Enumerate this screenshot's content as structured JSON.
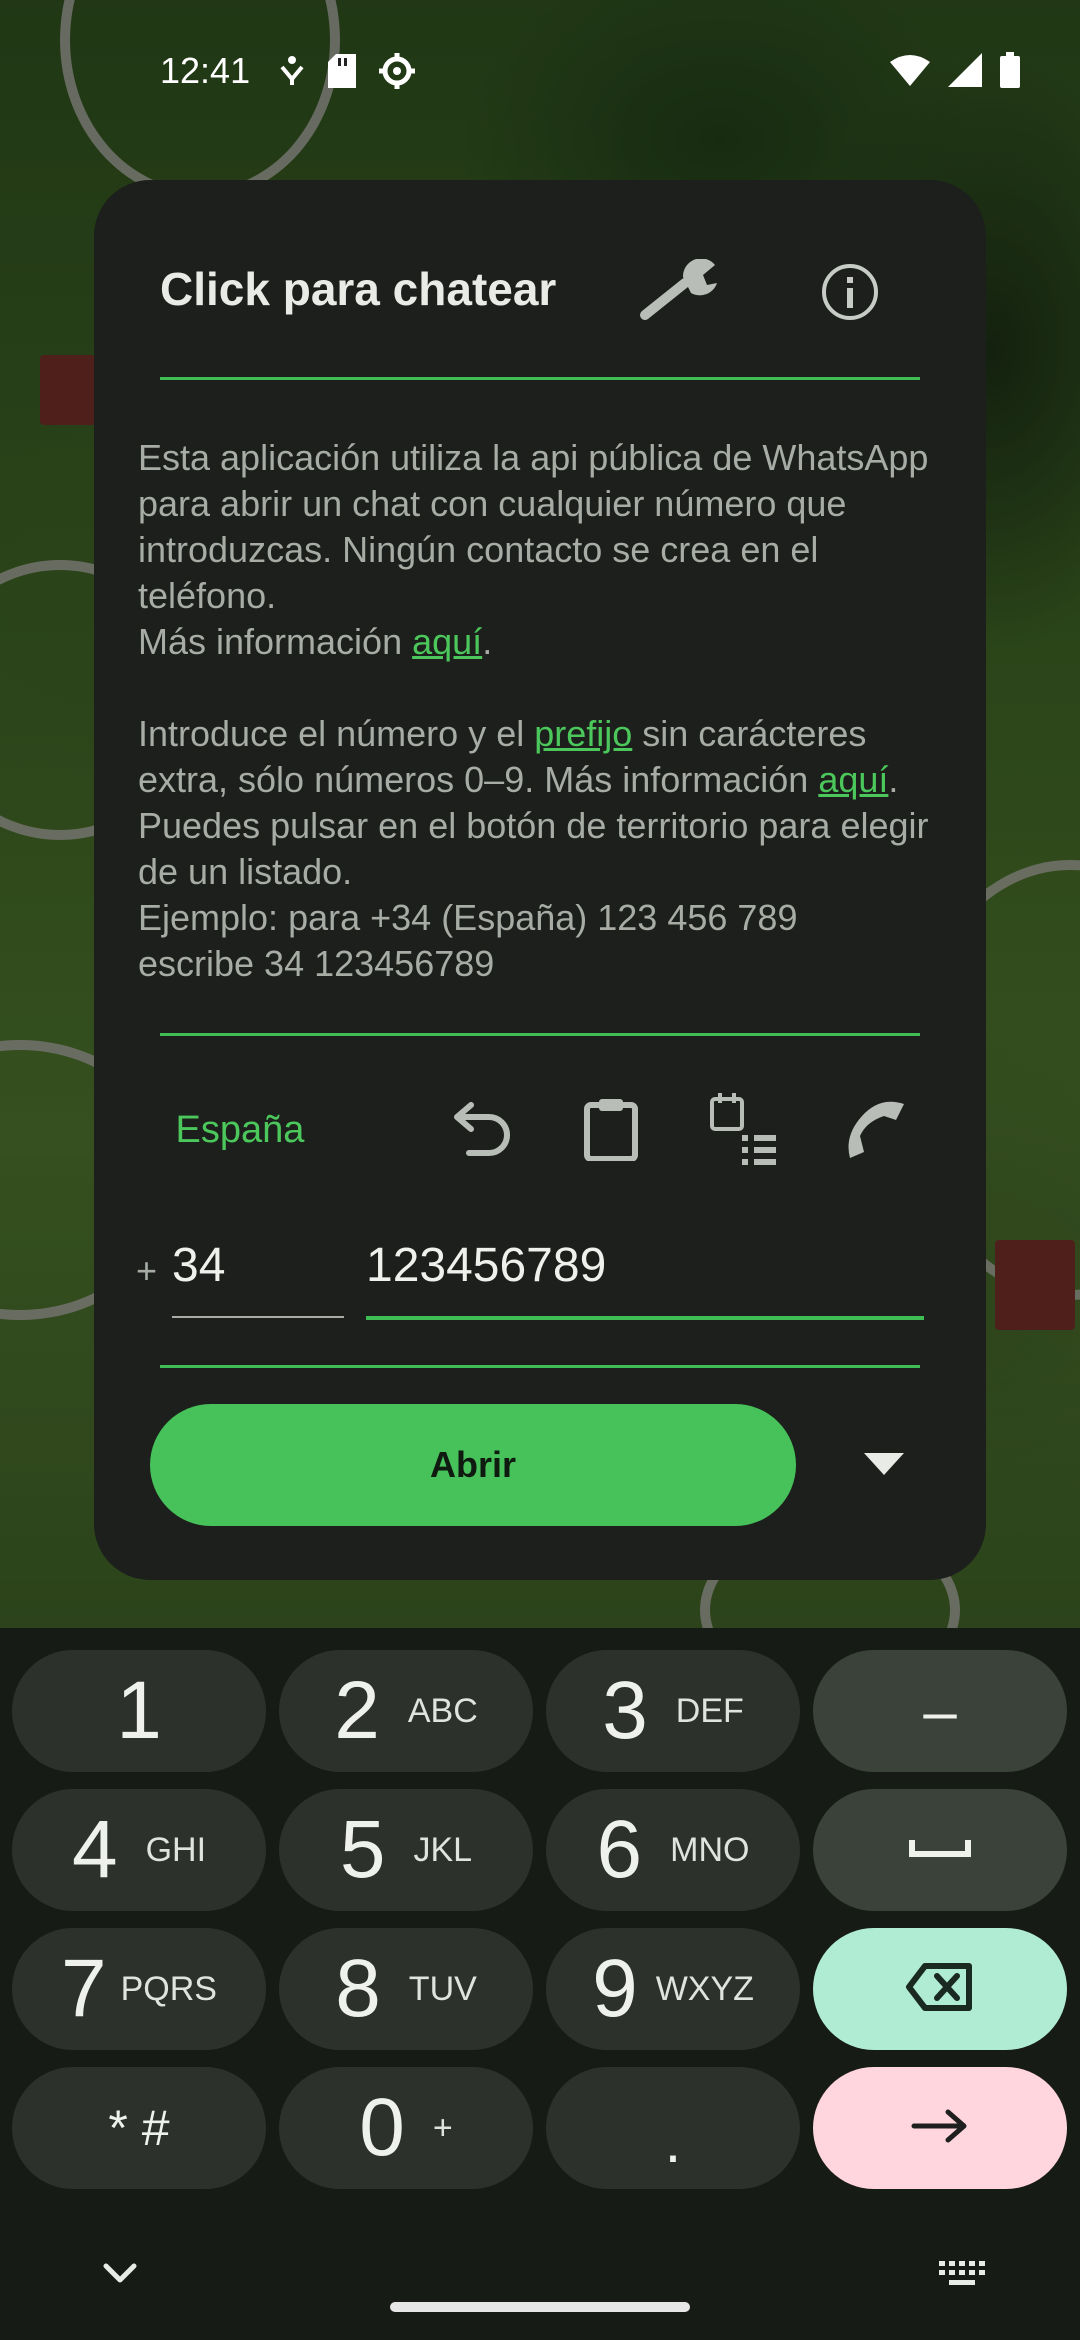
{
  "status_bar": {
    "time": "12:41"
  },
  "dialog": {
    "title": "Click para chatear",
    "description": {
      "p1": "Esta aplicación utiliza la api pública de WhatsApp para abrir un chat con cualquier número que introduzcas. Ningún contacto se crea en el teléfono.",
      "p1_more_prefix": "Más información ",
      "p1_more_link": "aquí",
      "p1_more_suffix": ".",
      "p2_prefix": "Introduce el número y el ",
      "p2_link_prefijo": "prefijo",
      "p2_middle": " sin carácteres extra, sólo números 0–9. Más información ",
      "p2_link_aqui": "aquí",
      "p2_suffix": ". Puedes pulsar en el botón de territorio para elegir de un listado.",
      "example_line1": "Ejemplo: para +34 (España) 123 456 789",
      "example_line2": "escribe 34 123456789"
    },
    "country_label": "España",
    "plus_sign": "+",
    "prefix_value": "34",
    "phone_value": "123456789",
    "open_button": "Abrir"
  },
  "keyboard": {
    "keys": {
      "k1": {
        "main": "1",
        "sub": ""
      },
      "k2": {
        "main": "2",
        "sub": "ABC"
      },
      "k3": {
        "main": "3",
        "sub": "DEF"
      },
      "k4": {
        "main": "4",
        "sub": "GHI"
      },
      "k5": {
        "main": "5",
        "sub": "JKL"
      },
      "k6": {
        "main": "6",
        "sub": "MNO"
      },
      "k7": {
        "main": "7",
        "sub": "PQRS"
      },
      "k8": {
        "main": "8",
        "sub": "TUV"
      },
      "k9": {
        "main": "9",
        "sub": "WXYZ"
      },
      "star_hash": "* #",
      "k0": {
        "main": "0",
        "sub": "+"
      },
      "dot": ".",
      "dash": "–"
    }
  },
  "colors": {
    "accent": "#47c15a",
    "dialog_bg": "#1c1f1b",
    "backspace_key": "#b0ecd4",
    "enter_key": "#ffd6de"
  },
  "icons": {
    "settings": "wrench-icon",
    "info": "info-icon",
    "undo": "undo-icon",
    "paste": "clipboard-icon",
    "history": "calendar-list-icon",
    "call": "phone-icon",
    "dropdown": "triangle-down-icon",
    "space": "space-icon",
    "backspace": "backspace-icon",
    "enter": "arrow-right-icon",
    "hide_keyboard": "chevron-down-icon",
    "keyboard_switch": "keyboard-icon"
  }
}
